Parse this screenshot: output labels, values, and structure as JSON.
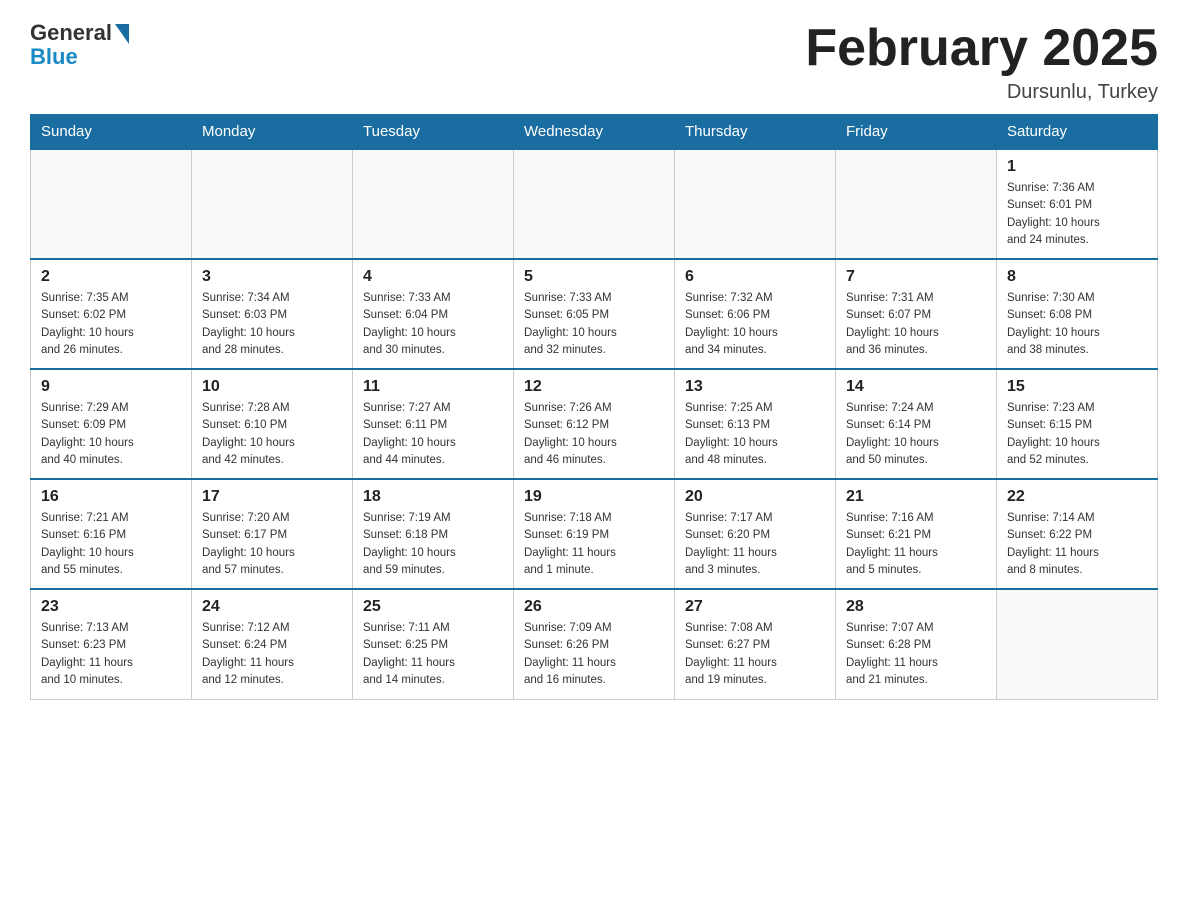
{
  "logo": {
    "general": "General",
    "blue": "Blue"
  },
  "header": {
    "title": "February 2025",
    "location": "Dursunlu, Turkey"
  },
  "weekdays": [
    "Sunday",
    "Monday",
    "Tuesday",
    "Wednesday",
    "Thursday",
    "Friday",
    "Saturday"
  ],
  "weeks": [
    [
      {
        "day": "",
        "info": ""
      },
      {
        "day": "",
        "info": ""
      },
      {
        "day": "",
        "info": ""
      },
      {
        "day": "",
        "info": ""
      },
      {
        "day": "",
        "info": ""
      },
      {
        "day": "",
        "info": ""
      },
      {
        "day": "1",
        "info": "Sunrise: 7:36 AM\nSunset: 6:01 PM\nDaylight: 10 hours\nand 24 minutes."
      }
    ],
    [
      {
        "day": "2",
        "info": "Sunrise: 7:35 AM\nSunset: 6:02 PM\nDaylight: 10 hours\nand 26 minutes."
      },
      {
        "day": "3",
        "info": "Sunrise: 7:34 AM\nSunset: 6:03 PM\nDaylight: 10 hours\nand 28 minutes."
      },
      {
        "day": "4",
        "info": "Sunrise: 7:33 AM\nSunset: 6:04 PM\nDaylight: 10 hours\nand 30 minutes."
      },
      {
        "day": "5",
        "info": "Sunrise: 7:33 AM\nSunset: 6:05 PM\nDaylight: 10 hours\nand 32 minutes."
      },
      {
        "day": "6",
        "info": "Sunrise: 7:32 AM\nSunset: 6:06 PM\nDaylight: 10 hours\nand 34 minutes."
      },
      {
        "day": "7",
        "info": "Sunrise: 7:31 AM\nSunset: 6:07 PM\nDaylight: 10 hours\nand 36 minutes."
      },
      {
        "day": "8",
        "info": "Sunrise: 7:30 AM\nSunset: 6:08 PM\nDaylight: 10 hours\nand 38 minutes."
      }
    ],
    [
      {
        "day": "9",
        "info": "Sunrise: 7:29 AM\nSunset: 6:09 PM\nDaylight: 10 hours\nand 40 minutes."
      },
      {
        "day": "10",
        "info": "Sunrise: 7:28 AM\nSunset: 6:10 PM\nDaylight: 10 hours\nand 42 minutes."
      },
      {
        "day": "11",
        "info": "Sunrise: 7:27 AM\nSunset: 6:11 PM\nDaylight: 10 hours\nand 44 minutes."
      },
      {
        "day": "12",
        "info": "Sunrise: 7:26 AM\nSunset: 6:12 PM\nDaylight: 10 hours\nand 46 minutes."
      },
      {
        "day": "13",
        "info": "Sunrise: 7:25 AM\nSunset: 6:13 PM\nDaylight: 10 hours\nand 48 minutes."
      },
      {
        "day": "14",
        "info": "Sunrise: 7:24 AM\nSunset: 6:14 PM\nDaylight: 10 hours\nand 50 minutes."
      },
      {
        "day": "15",
        "info": "Sunrise: 7:23 AM\nSunset: 6:15 PM\nDaylight: 10 hours\nand 52 minutes."
      }
    ],
    [
      {
        "day": "16",
        "info": "Sunrise: 7:21 AM\nSunset: 6:16 PM\nDaylight: 10 hours\nand 55 minutes."
      },
      {
        "day": "17",
        "info": "Sunrise: 7:20 AM\nSunset: 6:17 PM\nDaylight: 10 hours\nand 57 minutes."
      },
      {
        "day": "18",
        "info": "Sunrise: 7:19 AM\nSunset: 6:18 PM\nDaylight: 10 hours\nand 59 minutes."
      },
      {
        "day": "19",
        "info": "Sunrise: 7:18 AM\nSunset: 6:19 PM\nDaylight: 11 hours\nand 1 minute."
      },
      {
        "day": "20",
        "info": "Sunrise: 7:17 AM\nSunset: 6:20 PM\nDaylight: 11 hours\nand 3 minutes."
      },
      {
        "day": "21",
        "info": "Sunrise: 7:16 AM\nSunset: 6:21 PM\nDaylight: 11 hours\nand 5 minutes."
      },
      {
        "day": "22",
        "info": "Sunrise: 7:14 AM\nSunset: 6:22 PM\nDaylight: 11 hours\nand 8 minutes."
      }
    ],
    [
      {
        "day": "23",
        "info": "Sunrise: 7:13 AM\nSunset: 6:23 PM\nDaylight: 11 hours\nand 10 minutes."
      },
      {
        "day": "24",
        "info": "Sunrise: 7:12 AM\nSunset: 6:24 PM\nDaylight: 11 hours\nand 12 minutes."
      },
      {
        "day": "25",
        "info": "Sunrise: 7:11 AM\nSunset: 6:25 PM\nDaylight: 11 hours\nand 14 minutes."
      },
      {
        "day": "26",
        "info": "Sunrise: 7:09 AM\nSunset: 6:26 PM\nDaylight: 11 hours\nand 16 minutes."
      },
      {
        "day": "27",
        "info": "Sunrise: 7:08 AM\nSunset: 6:27 PM\nDaylight: 11 hours\nand 19 minutes."
      },
      {
        "day": "28",
        "info": "Sunrise: 7:07 AM\nSunset: 6:28 PM\nDaylight: 11 hours\nand 21 minutes."
      },
      {
        "day": "",
        "info": ""
      }
    ]
  ]
}
